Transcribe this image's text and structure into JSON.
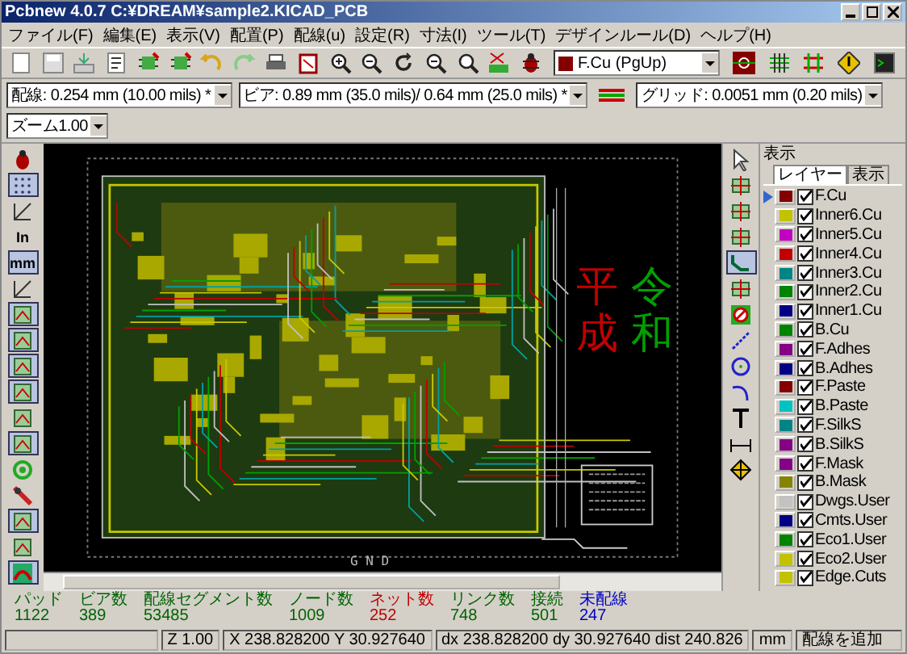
{
  "window": {
    "title": "Pcbnew 4.0.7 C:¥DREAM¥sample2.KICAD_PCB"
  },
  "menu": [
    "ファイル(F)",
    "編集(E)",
    "表示(V)",
    "配置(P)",
    "配線(u)",
    "設定(R)",
    "寸法(I)",
    "ツール(T)",
    "デザインルール(D)",
    "ヘルプ(H)"
  ],
  "layer_select": {
    "value": "F.Cu (PgUp)",
    "color": "#840000"
  },
  "dropdowns": [
    "配線: 0.254 mm (10.00 mils) *",
    "ビア: 0.89 mm (35.0 mils)/ 0.64 mm (25.0 mils) *",
    "グリッド: 0.0051 mm (0.20 mils)",
    "ズーム1.00"
  ],
  "left_toolbar": [
    {
      "on": false
    },
    {
      "on": true
    },
    {
      "on": false
    },
    {
      "on": false,
      "label": "In"
    },
    {
      "on": true,
      "label": "mm"
    },
    {
      "on": false
    },
    {
      "on": true
    },
    {
      "on": true
    },
    {
      "on": true
    },
    {
      "on": true
    },
    {
      "on": false
    },
    {
      "on": true
    },
    {
      "on": false
    },
    {
      "on": false
    },
    {
      "on": true
    },
    {
      "on": false
    },
    {
      "on": true
    }
  ],
  "right_toolbar": [
    {
      "on": false
    },
    {
      "on": false
    },
    {
      "on": false
    },
    {
      "on": false
    },
    {
      "on": true
    },
    {
      "on": false
    },
    {
      "on": false
    },
    {
      "on": false
    },
    {
      "on": false
    },
    {
      "on": false
    },
    {
      "on": false
    },
    {
      "on": false
    },
    {
      "on": false
    }
  ],
  "canvas": {
    "board_label": "G N D",
    "texts": [
      {
        "text": "平成",
        "color": "#c20000"
      },
      {
        "text": "令和",
        "color": "#00a000"
      }
    ]
  },
  "panel": {
    "title": "表示",
    "tabs": [
      {
        "label": "レイヤー",
        "selected": true
      },
      {
        "label": "表示",
        "selected": false
      }
    ],
    "layers": [
      {
        "name": "F.Cu",
        "color": "#840000",
        "checked": true,
        "selected": true
      },
      {
        "name": "Inner6.Cu",
        "color": "#c2c200",
        "checked": true,
        "selected": false
      },
      {
        "name": "Inner5.Cu",
        "color": "#c200c2",
        "checked": true,
        "selected": false
      },
      {
        "name": "Inner4.Cu",
        "color": "#c20000",
        "checked": true,
        "selected": false
      },
      {
        "name": "Inner3.Cu",
        "color": "#008484",
        "checked": true,
        "selected": false
      },
      {
        "name": "Inner2.Cu",
        "color": "#008400",
        "checked": true,
        "selected": false
      },
      {
        "name": "Inner1.Cu",
        "color": "#000084",
        "checked": true,
        "selected": false
      },
      {
        "name": "B.Cu",
        "color": "#008400",
        "checked": true,
        "selected": false
      },
      {
        "name": "F.Adhes",
        "color": "#840084",
        "checked": true,
        "selected": false
      },
      {
        "name": "B.Adhes",
        "color": "#000084",
        "checked": true,
        "selected": false
      },
      {
        "name": "F.Paste",
        "color": "#840000",
        "checked": true,
        "selected": false
      },
      {
        "name": "B.Paste",
        "color": "#00c2c2",
        "checked": true,
        "selected": false
      },
      {
        "name": "F.SilkS",
        "color": "#008484",
        "checked": true,
        "selected": false
      },
      {
        "name": "B.SilkS",
        "color": "#840084",
        "checked": true,
        "selected": false
      },
      {
        "name": "F.Mask",
        "color": "#840084",
        "checked": true,
        "selected": false
      },
      {
        "name": "B.Mask",
        "color": "#848400",
        "checked": true,
        "selected": false
      },
      {
        "name": "Dwgs.User",
        "color": "#c2c2c2",
        "checked": true,
        "selected": false
      },
      {
        "name": "Cmts.User",
        "color": "#000084",
        "checked": true,
        "selected": false
      },
      {
        "name": "Eco1.User",
        "color": "#008400",
        "checked": true,
        "selected": false
      },
      {
        "name": "Eco2.User",
        "color": "#c2c200",
        "checked": true,
        "selected": false
      },
      {
        "name": "Edge.Cuts",
        "color": "#c2c200",
        "checked": true,
        "selected": false
      }
    ]
  },
  "stats": [
    {
      "label": "パッド",
      "value": "1122",
      "color": "#006400"
    },
    {
      "label": "ビア数",
      "value": "389",
      "color": "#006400"
    },
    {
      "label": "配線セグメント数",
      "value": "53485",
      "color": "#006400"
    },
    {
      "label": "ノード数",
      "value": "1009",
      "color": "#006400"
    },
    {
      "label": "ネット数",
      "value": "252",
      "color": "#c00000"
    },
    {
      "label": "リンク数",
      "value": "748",
      "color": "#006400"
    },
    {
      "label": "接続",
      "value": "501",
      "color": "#006400"
    },
    {
      "label": "未配線",
      "value": "247",
      "color": "#0000c0"
    }
  ],
  "status_bar": {
    "zoom": "Z 1.00",
    "position": "X 238.828200  Y 30.927640",
    "delta": "dx 238.828200  dy 30.927640  dist 240.826",
    "units": "mm",
    "message": "配線を追加"
  }
}
